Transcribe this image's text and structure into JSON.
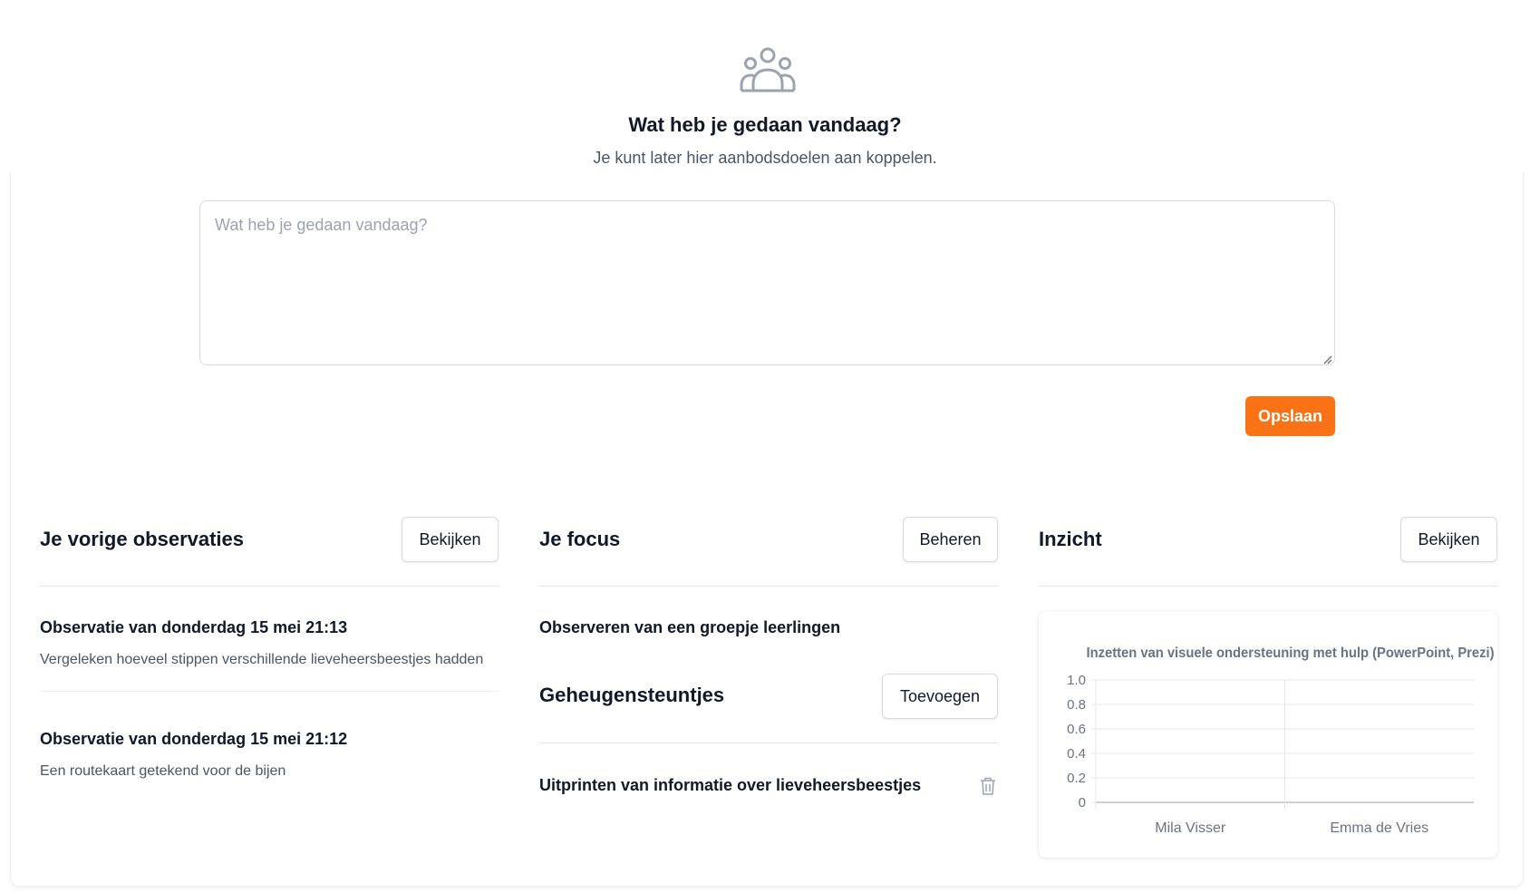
{
  "hero": {
    "icon": "users-group-icon",
    "title": "Wat heb je gedaan vandaag?",
    "subtitle": "Je kunt later hier aanbodsdoelen aan koppelen."
  },
  "entry": {
    "placeholder": "Wat heb je gedaan vandaag?",
    "value": "",
    "save_label": "Opslaan"
  },
  "observations": {
    "title": "Je vorige observaties",
    "button": "Bekijken",
    "items": [
      {
        "title": "Observatie van donderdag 15 mei 21:13",
        "description": "Vergeleken hoeveel stippen verschillende lieveheersbeestjes hadden"
      },
      {
        "title": "Observatie van donderdag 15 mei 21:12",
        "description": "Een routekaart getekend voor de bijen"
      }
    ]
  },
  "focus": {
    "title": "Je focus",
    "button": "Beheren",
    "item": "Observeren van een groepje leerlingen",
    "memos": {
      "title": "Geheugensteuntjes",
      "button": "Toevoegen",
      "items": [
        {
          "text": "Uitprinten van informatie over lieveheersbeestjes",
          "icon": "trash-icon"
        }
      ]
    }
  },
  "insight": {
    "title": "Inzicht",
    "button": "Bekijken"
  },
  "chart_data": {
    "type": "bar",
    "title": "Inzetten van visuele ondersteuning met hulp (PowerPoint, Prezi)",
    "categories": [
      "Mila Visser",
      "Emma de Vries"
    ],
    "values": [
      0,
      0
    ],
    "ylim": [
      0,
      1.0
    ],
    "yticks": [
      "1.0",
      "0.8",
      "0.6",
      "0.4",
      "0.2",
      "0"
    ],
    "xlabel": "",
    "ylabel": "",
    "grid": true,
    "colors": {
      "grid": "#e5e7eb",
      "axis": "#9ca3af",
      "text": "#6b7280",
      "title": "#6b7280"
    }
  }
}
